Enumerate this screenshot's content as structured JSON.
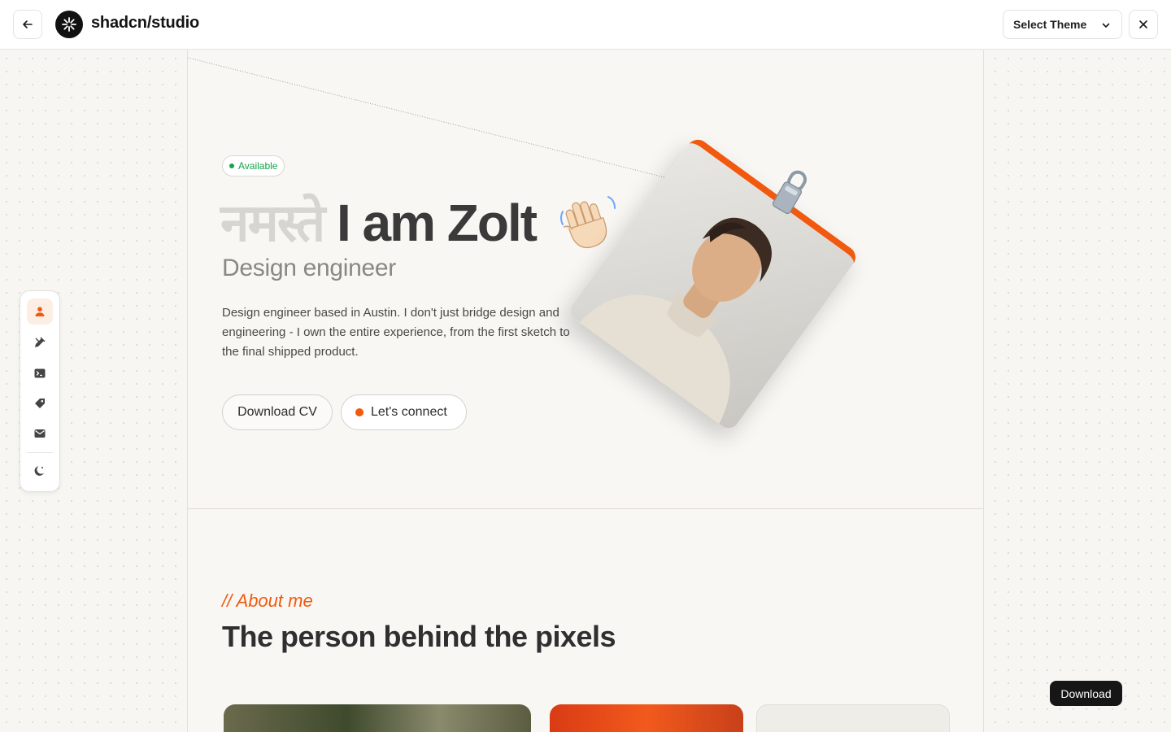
{
  "header": {
    "brand": "shadcn/studio",
    "theme_select_label": "Select Theme"
  },
  "hero": {
    "badge": "Available",
    "greeting": "नमस्ते",
    "headline": "I am Zolt",
    "role": "Design engineer",
    "description": "Design engineer based in Austin. I don't just bridge design and engineering - I own the entire experience, from the first sketch to the final shipped product.",
    "download_cv": "Download CV",
    "connect": "Let's connect"
  },
  "about": {
    "kicker": "// About me",
    "title": "The person behind the pixels"
  },
  "tooltip": "Download",
  "colors": {
    "accent": "#f0590e",
    "available": "#16a34a"
  },
  "icons": {
    "dock": [
      "user-icon",
      "pencil-ruler-icon",
      "terminal-icon",
      "tag-icon",
      "mail-icon",
      "moon-icon"
    ]
  }
}
